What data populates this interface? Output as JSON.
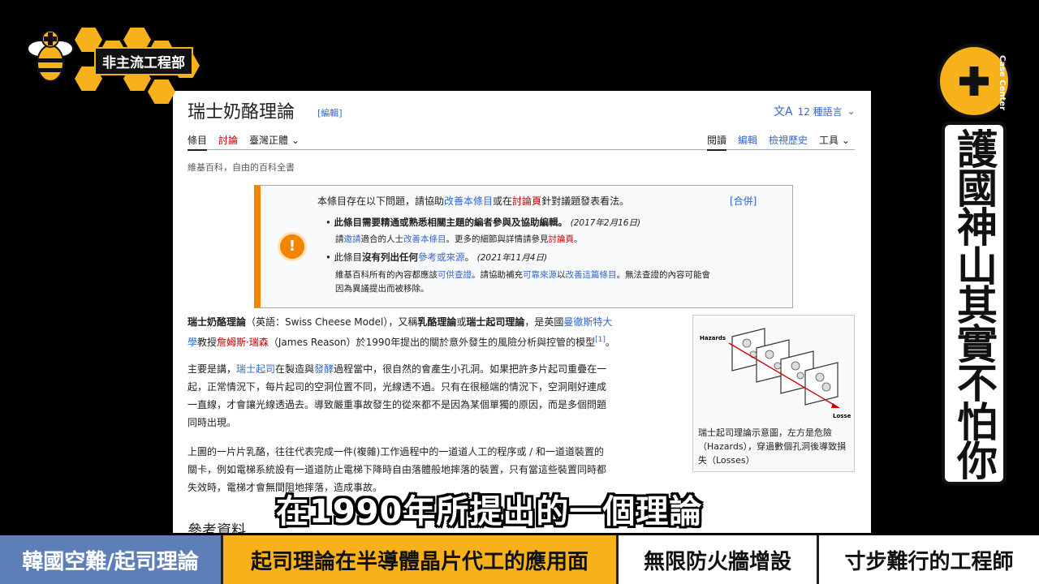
{
  "channel": {
    "name": "非主流工程部",
    "badge_text": "Case Center"
  },
  "side_banner": "護國神山其實不怕你出包",
  "subtitle": "在1990年所提出的一個理論",
  "bottom_bar": [
    "韓國空難/起司理論",
    "起司理論在半導體晶片代工的應用面",
    "無限防火牆增設",
    "寸步難行的工程師"
  ],
  "wiki": {
    "title": "瑞士奶酪理論",
    "edit": "[編輯]",
    "languages": "12 種語言",
    "tabs_left": [
      "條目",
      "討論",
      "臺灣正體"
    ],
    "tabs_right": [
      "閱讀",
      "編輯",
      "檢視歷史",
      "工具"
    ],
    "tagline": "維基百科，自由的百科全書",
    "notice": {
      "head_a": "本條目存在以下問題，請協助",
      "head_link1": "改善本條目",
      "head_b": "或在",
      "head_link2": "討論頁",
      "head_c": "針對議題發表看法。",
      "merge": "[合併]",
      "item1": "此條目需要精通或熟悉相關主題的編者參與及協助編輯。",
      "item1_date": "(2017年2月16日)",
      "item1_sub_a": "請",
      "item1_sub_link1": "邀請",
      "item1_sub_b": "適合的人士",
      "item1_sub_link2": "改善本條目",
      "item1_sub_c": "。更多的細節與詳情請參見",
      "item1_sub_link3": "討論頁",
      "item1_sub_d": "。",
      "item2_a": "此條目",
      "item2_b": "沒有列出任何",
      "item2_link": "參考或來源",
      "item2_c": "。",
      "item2_date": "(2021年11月4日)",
      "item2_sub_a": "維基百科所有的內容都應該",
      "item2_sub_link1": "可供查證",
      "item2_sub_b": "。請協助補充",
      "item2_sub_link2": "可靠來源",
      "item2_sub_c": "以",
      "item2_sub_link3": "改善這篇條目",
      "item2_sub_d": "。無法查證的內容可能會",
      "item2_sub_e": "因為異議提出而被移除。"
    },
    "p1_a": "瑞士奶酪理論",
    "p1_b": "（英語：Swiss Cheese Model），又稱",
    "p1_c": "乳酪理論",
    "p1_d": "或",
    "p1_e": "瑞士起司理論",
    "p1_f": "，是英國",
    "p1_link1": "曼徹斯特大",
    "p1_link1b": "學",
    "p1_g": "教授",
    "p1_link2": "詹姆斯·瑞森",
    "p1_h": "（James Reason）於1990年提出的關於意外發生的風險分析與控管的模型",
    "p1_ref": "[1]",
    "p1_i": "。",
    "p2_a": "主要是講，",
    "p2_link1": "瑞士起司",
    "p2_b": "在製造與",
    "p2_link2": "發酵",
    "p2_c": "過程當中，很自然的會產生小孔洞。如果把許多片起司重疊在一",
    "p2_d": "起，正常情況下，每片起司的空洞位置不同，光線透不過。只有在很極端的情況下，空洞剛好連成",
    "p2_e": "一直線，才會讓光線透過去。導致嚴重事故發生的從來都不是因為某個單獨的原因，而是多個問題",
    "p2_f": "同時出現。",
    "p3_a": "上圖的一片片乳酪，往往代表完成一件(複雜)工作過程中的一道道人工的程序或 / 和一道道裝置的",
    "p3_b": "關卡，例如電梯系統設有一道道防止電梯下降時自由落體般地摔落的裝置，只有當這些裝置同時都",
    "p3_c": "失效時，電梯才會無間阻地摔落，造成事故。",
    "refs": "參考資料",
    "figure": {
      "hazards": "Hazards",
      "losses": "Losses",
      "caption": "瑞士起司理論示意圖，左方是危險（Hazards），穿過數個孔洞後導致損失（Losses）"
    }
  }
}
